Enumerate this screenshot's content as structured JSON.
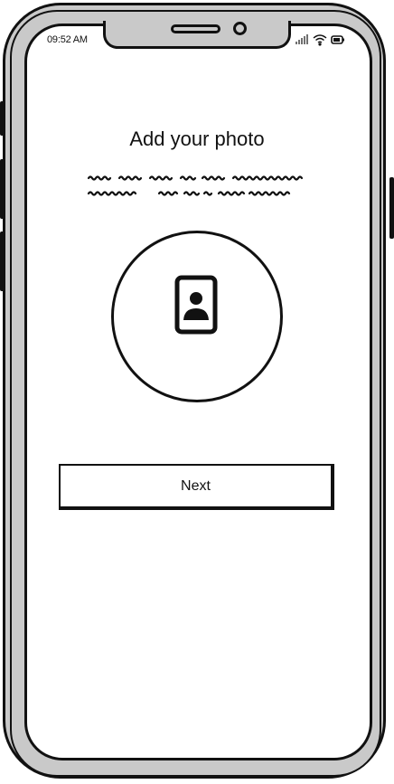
{
  "status_bar": {
    "time": "09:52 AM",
    "signal_icon": "signal-icon",
    "wifi_icon": "wifi-icon",
    "battery_icon": "battery-icon"
  },
  "screen": {
    "title": "Add your photo",
    "photo_icon": "person-badge-icon"
  },
  "actions": {
    "next_label": "Next"
  }
}
